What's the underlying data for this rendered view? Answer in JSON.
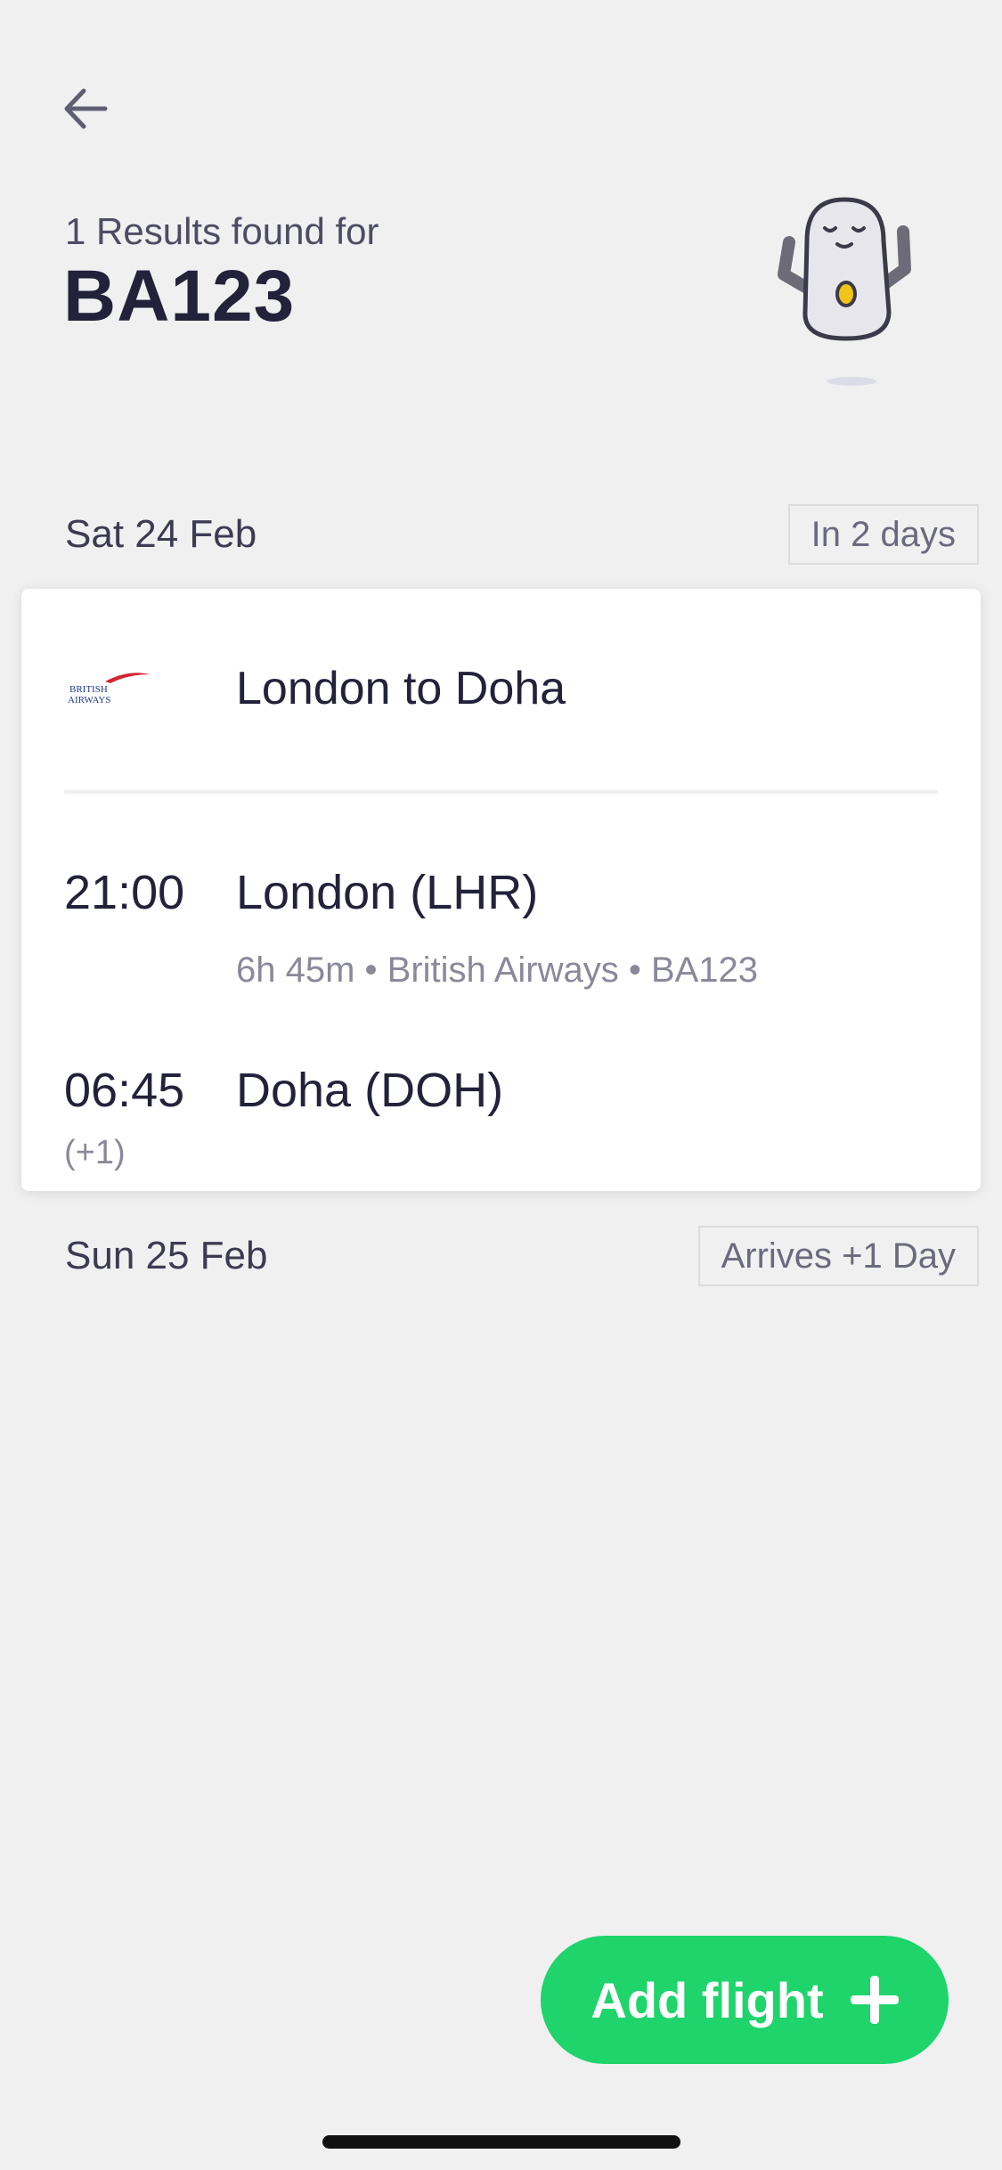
{
  "header": {
    "subtitle": "1 Results found for",
    "query": "BA123"
  },
  "departure": {
    "date": "Sat 24 Feb",
    "badge": "In 2 days"
  },
  "flight": {
    "airline_logo_text": "BRITISH AIRWAYS",
    "route": "London to Doha",
    "depart_time": "21:00",
    "depart_place": "London (LHR)",
    "details": "6h 45m • British Airways • BA123",
    "arrive_time": "06:45",
    "arrive_place": "Doha (DOH)",
    "day_offset": "(+1)"
  },
  "arrival": {
    "date": "Sun 25 Feb",
    "badge": "Arrives +1 Day"
  },
  "actions": {
    "add_flight_label": "Add flight"
  },
  "colors": {
    "accent": "#1ed46b",
    "background": "#f0f0f1",
    "text": "#23223a"
  },
  "icons": {
    "back": "arrow-left-icon",
    "add": "plus-icon",
    "mascot": "mascot-illustration"
  }
}
